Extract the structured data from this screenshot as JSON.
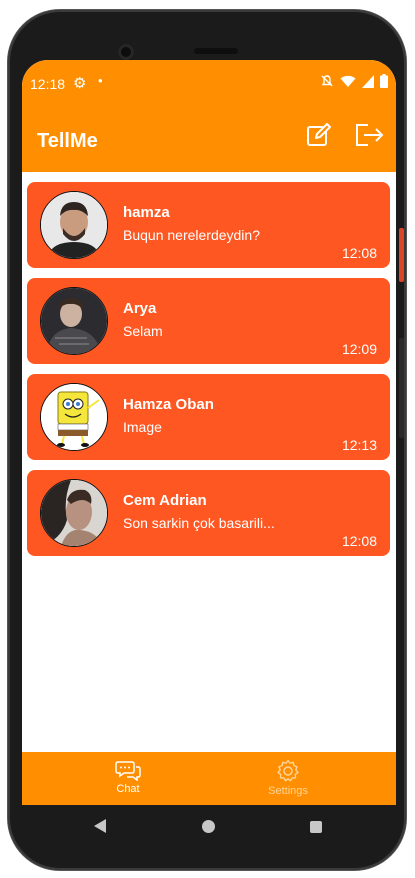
{
  "status_bar": {
    "time": "12:18"
  },
  "app_bar": {
    "title": "TellMe"
  },
  "chats": [
    {
      "name": "hamza",
      "message": "Buqun nerelerdeydin?",
      "time": "12:08"
    },
    {
      "name": "Arya",
      "message": "Selam",
      "time": "12:09"
    },
    {
      "name": "Hamza Oban",
      "message": "Image",
      "time": "12:13"
    },
    {
      "name": "Cem Adrian",
      "message": "Son sarkin çok basarili...",
      "time": "12:08"
    }
  ],
  "bottom_nav": {
    "chat_label": "Chat",
    "settings_label": "Settings"
  },
  "colors": {
    "app_bar": "#ff8f00",
    "card": "#ff5722"
  }
}
